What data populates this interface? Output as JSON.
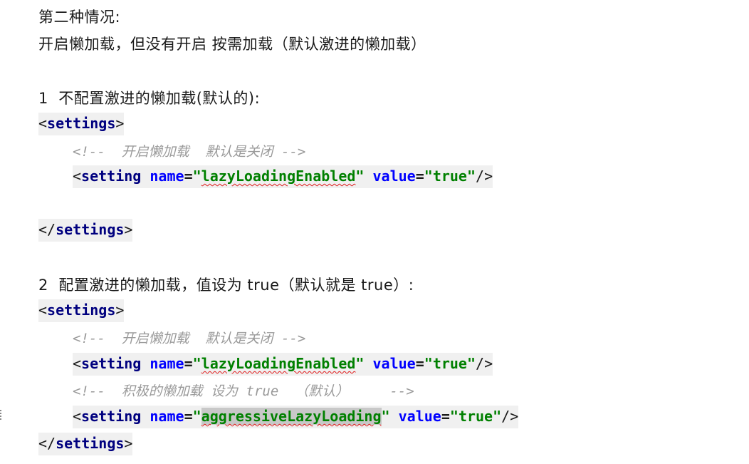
{
  "heading": "第二种情况:",
  "subheading": "开启懒加载，但没有开启 按需加载（默认激进的懒加载）",
  "section1": {
    "title": "1  不配置激进的懒加载(默认的):",
    "open_tag": "settings",
    "comment": "<!--  开启懒加载  默认是关闭 -->",
    "setting": {
      "tag": "setting",
      "name_attr": "name",
      "name_value": "lazyLoadingEnabled",
      "value_attr": "value",
      "value_value": "true"
    },
    "close_tag": "settings"
  },
  "section2": {
    "title": "2  配置激进的懒加载，值设为 true（默认就是 true）:",
    "open_tag": "settings",
    "comment1": "<!--  开启懒加载  默认是关闭 -->",
    "setting1": {
      "tag": "setting",
      "name_attr": "name",
      "name_value": "lazyLoadingEnabled",
      "value_attr": "value",
      "value_value": "true"
    },
    "comment2": "<!--  积极的懒加载 设为 true  （默认）     -->",
    "setting2": {
      "tag": "setting",
      "name_attr": "name",
      "name_value": "aggressiveLazyLoading",
      "value_attr": "value",
      "value_value": "true"
    },
    "close_tag": "settings"
  }
}
